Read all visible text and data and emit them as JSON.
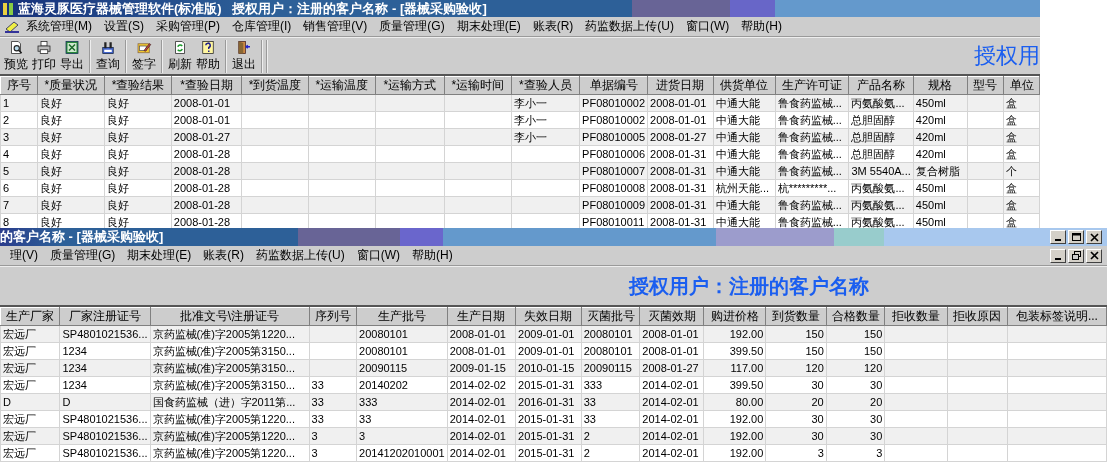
{
  "main_window": {
    "title": "蓝海灵豚医疗器械管理软件(标准版)   授权用户：注册的客户名称 - [器械采购验收]",
    "menu": [
      "系统管理(M)",
      "设置(S)",
      "采购管理(P)",
      "仓库管理(I)",
      "销售管理(V)",
      "质量管理(G)",
      "期末处理(E)",
      "账表(R)",
      "药监数据上传(U)",
      "窗口(W)",
      "帮助(H)"
    ],
    "toolbar_groups": [
      [
        {
          "label": "预览",
          "kind": "preview"
        },
        {
          "label": "打印",
          "kind": "print"
        },
        {
          "label": "导出",
          "kind": "export"
        }
      ],
      [
        {
          "label": "查询",
          "kind": "query"
        }
      ],
      [
        {
          "label": "签字",
          "kind": "sign"
        }
      ],
      [
        {
          "label": "刷新",
          "kind": "refresh"
        },
        {
          "label": "帮助",
          "kind": "help"
        }
      ],
      [
        {
          "label": "退出",
          "kind": "exit"
        }
      ]
    ],
    "banner": "授权用",
    "table": {
      "columns": [
        {
          "label": "序号"
        },
        {
          "label": "*质量状况"
        },
        {
          "label": "*查验结果"
        },
        {
          "label": "*查验日期"
        },
        {
          "label": "*到货温度"
        },
        {
          "label": "*运输温度"
        },
        {
          "label": "*运输方式"
        },
        {
          "label": "*运输时间"
        },
        {
          "label": "*查验人员"
        },
        {
          "label": "单据编号"
        },
        {
          "label": "进货日期"
        },
        {
          "label": "供货单位"
        },
        {
          "label": "生产许可证"
        },
        {
          "label": "产品名称"
        },
        {
          "label": "规格"
        },
        {
          "label": "型号"
        },
        {
          "label": "单位"
        }
      ],
      "rows": [
        [
          "1",
          "良好",
          "良好",
          "2008-01-01",
          null,
          null,
          null,
          null,
          "李小一",
          "PF08010002",
          "2008-01-01",
          "中通大能",
          "鲁食药监械...",
          "丙氨酸氨...",
          "450ml",
          null,
          "盒"
        ],
        [
          "2",
          "良好",
          "良好",
          "2008-01-01",
          null,
          null,
          null,
          null,
          "李小一",
          "PF08010002",
          "2008-01-01",
          "中通大能",
          "鲁食药监械...",
          "总胆固醇",
          "420ml",
          null,
          "盒"
        ],
        [
          "3",
          "良好",
          "良好",
          "2008-01-27",
          null,
          null,
          null,
          null,
          "李小一",
          "PF08010005",
          "2008-01-27",
          "中通大能",
          "鲁食药监械...",
          "总胆固醇",
          "420ml",
          null,
          "盒"
        ],
        [
          "4",
          "良好",
          "良好",
          "2008-01-28",
          null,
          null,
          null,
          null,
          null,
          "PF08010006",
          "2008-01-31",
          "中通大能",
          "鲁食药监械...",
          "总胆固醇",
          "420ml",
          null,
          "盒"
        ],
        [
          "5",
          "良好",
          "良好",
          "2008-01-28",
          null,
          null,
          null,
          null,
          null,
          "PF08010007",
          "2008-01-31",
          "中通大能",
          "鲁食药监械...",
          "3M 5540A...",
          "复合树脂",
          null,
          "个"
        ],
        [
          "6",
          "良好",
          "良好",
          "2008-01-28",
          null,
          null,
          null,
          null,
          null,
          "PF08010008",
          "2008-01-31",
          "杭州天能...",
          "杭*********...",
          "丙氨酸氨...",
          "450ml",
          null,
          "盒"
        ],
        [
          "7",
          "良好",
          "良好",
          "2008-01-28",
          null,
          null,
          null,
          null,
          null,
          "PF08010009",
          "2008-01-31",
          "中通大能",
          "鲁食药监械...",
          "丙氨酸氨...",
          "450ml",
          null,
          "盒"
        ],
        [
          "8",
          "良好",
          "良好",
          "2008-01-28",
          null,
          null,
          null,
          null,
          null,
          "PF08010011",
          "2008-01-31",
          "中通大能",
          "鲁食药监械...",
          "丙氨酸氨...",
          "450ml",
          null,
          "盒"
        ]
      ]
    }
  },
  "child_window": {
    "title": "的客户名称 - [器械采购验收]",
    "menu": [
      "理(V)",
      "质量管理(G)",
      "期末处理(E)",
      "账表(R)",
      "药监数据上传(U)",
      "窗口(W)",
      "帮助(H)"
    ],
    "banner": "授权用户：注册的客户名称",
    "table": {
      "columns": [
        {
          "label": "生产厂家"
        },
        {
          "label": "厂家注册证号"
        },
        {
          "label": "批准文号\\注册证号"
        },
        {
          "label": "序列号"
        },
        {
          "label": "生产批号"
        },
        {
          "label": "生产日期"
        },
        {
          "label": "失效日期"
        },
        {
          "label": "灭菌批号"
        },
        {
          "label": "灭菌效期"
        },
        {
          "label": "购进价格",
          "numeric": true
        },
        {
          "label": "到货数量",
          "numeric": true
        },
        {
          "label": "合格数量",
          "numeric": true
        },
        {
          "label": "拒收数量"
        },
        {
          "label": "拒收原因"
        },
        {
          "label": "包装标签说明..."
        }
      ],
      "rows": [
        [
          "宏远厂",
          "SP4801021536...",
          "京药监械(准)字2005第1220...",
          null,
          "20080101",
          "2008-01-01",
          "2009-01-01",
          "20080101",
          "2008-01-01",
          "192.00",
          "150",
          "150",
          null,
          null,
          null
        ],
        [
          "宏远厂",
          "1234",
          "京药监械(准)字2005第3150...",
          null,
          "20080101",
          "2008-01-01",
          "2009-01-01",
          "20080101",
          "2008-01-01",
          "399.50",
          "150",
          "150",
          null,
          null,
          null
        ],
        [
          "宏远厂",
          "1234",
          "京药监械(准)字2005第3150...",
          null,
          "20090115",
          "2009-01-15",
          "2010-01-15",
          "20090115",
          "2008-01-27",
          "117.00",
          "120",
          "120",
          null,
          null,
          null
        ],
        [
          "宏远厂",
          "1234",
          "京药监械(准)字2005第3150...",
          "33",
          "20140202",
          "2014-02-02",
          "2015-01-31",
          "333",
          "2014-02-01",
          "399.50",
          "30",
          "30",
          null,
          null,
          null
        ],
        [
          "D",
          "D",
          "国食药监械（进）字2011第...",
          "33",
          "333",
          "2014-02-01",
          "2016-01-31",
          "33",
          "2014-02-01",
          "80.00",
          "20",
          "20",
          null,
          null,
          null
        ],
        [
          "宏远厂",
          "SP4801021536...",
          "京药监械(准)字2005第1220...",
          "33",
          "33",
          "2014-02-01",
          "2015-01-31",
          "33",
          "2014-02-01",
          "192.00",
          "30",
          "30",
          null,
          null,
          null
        ],
        [
          "宏远厂",
          "SP4801021536...",
          "京药监械(准)字2005第1220...",
          "3",
          "3",
          "2014-02-01",
          "2015-01-31",
          "2",
          "2014-02-01",
          "192.00",
          "30",
          "30",
          null,
          null,
          null
        ],
        [
          "宏远厂",
          "SP4801021536...",
          "京药监械(准)字2005第1220...",
          "3",
          "20141202010001",
          "2014-02-01",
          "2015-01-31",
          "2",
          "2014-02-01",
          "192.00",
          "3",
          "3",
          null,
          null,
          null
        ]
      ]
    }
  }
}
